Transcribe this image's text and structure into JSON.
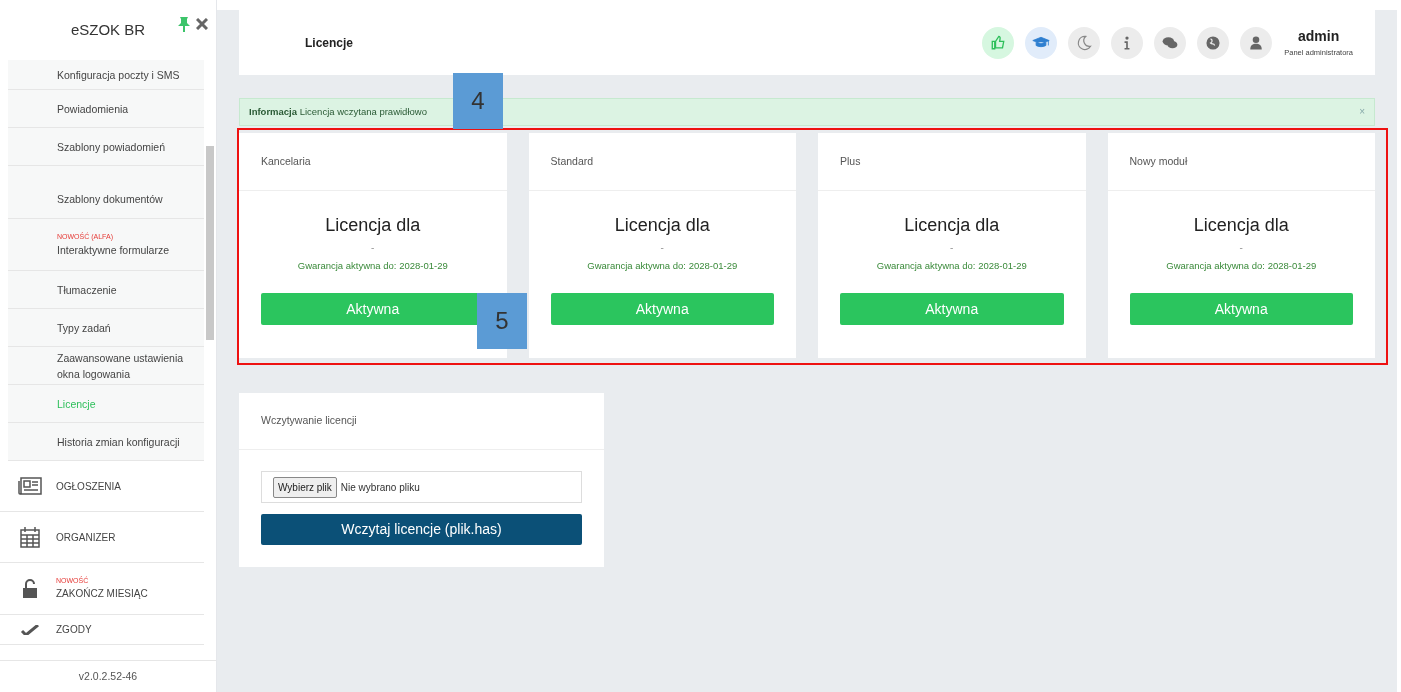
{
  "sidebar": {
    "title": "eSZOK BR",
    "items": [
      {
        "kind": "sub",
        "label": "Konfiguracja poczty i SMS",
        "selected": false
      },
      {
        "kind": "sub",
        "label": "Powiadomienia",
        "selected": false
      },
      {
        "kind": "sub",
        "label": "Szablony powiadomień",
        "selected": false
      },
      {
        "kind": "sub",
        "label": "Szablony dokumentów",
        "selected": false
      },
      {
        "kind": "sub",
        "badge": "NOWOŚĆ (ALFA)",
        "label": "Interaktywne formularze",
        "selected": false
      },
      {
        "kind": "sub",
        "label": "Tłumaczenie",
        "selected": false
      },
      {
        "kind": "sub",
        "label": "Typy zadań",
        "selected": false
      },
      {
        "kind": "sub",
        "label": "Zaawansowane ustawienia okna logowania",
        "selected": false
      },
      {
        "kind": "sub",
        "label": "Licencje",
        "selected": true
      },
      {
        "kind": "sub",
        "label": "Historia zmian konfiguracji",
        "selected": false
      },
      {
        "kind": "main",
        "label": "OGŁOSZENIA",
        "selected": false
      },
      {
        "kind": "main",
        "label": "ORGANIZER",
        "selected": false
      },
      {
        "kind": "main",
        "badge": "NOWOŚĆ",
        "label": "ZAKOŃCZ MIESIĄC",
        "selected": false
      },
      {
        "kind": "main",
        "label": "ZGODY",
        "selected": false
      }
    ],
    "version": "v2.0.2.52-46"
  },
  "header": {
    "title": "Licencje",
    "user": "admin",
    "role": "Panel administratora"
  },
  "alert": {
    "title": "Informacja",
    "message": "Licencja wczytana prawidłowo",
    "close": "×"
  },
  "licenses": [
    {
      "name": "Kancelaria",
      "heading": "Licencja dla",
      "owner": "-",
      "warranty": "Gwarancja aktywna do: 2028-01-29",
      "button": "Aktywna"
    },
    {
      "name": "Standard",
      "heading": "Licencja dla",
      "owner": "-",
      "warranty": "Gwarancja aktywna do: 2028-01-29",
      "button": "Aktywna"
    },
    {
      "name": "Plus",
      "heading": "Licencja dla",
      "owner": "-",
      "warranty": "Gwarancja aktywna do: 2028-01-29",
      "button": "Aktywna"
    },
    {
      "name": "Nowy moduł",
      "heading": "Licencja dla",
      "owner": "-",
      "warranty": "Gwarancja aktywna do: 2028-01-29",
      "button": "Aktywna"
    }
  ],
  "upload": {
    "title": "Wczytywanie licencji",
    "file_button": "Wybierz plik",
    "file_status": "Nie wybrano pliku",
    "submit": "Wczytaj licencje (plik.has)"
  },
  "annotations": [
    {
      "label": "4"
    },
    {
      "label": "5"
    }
  ]
}
